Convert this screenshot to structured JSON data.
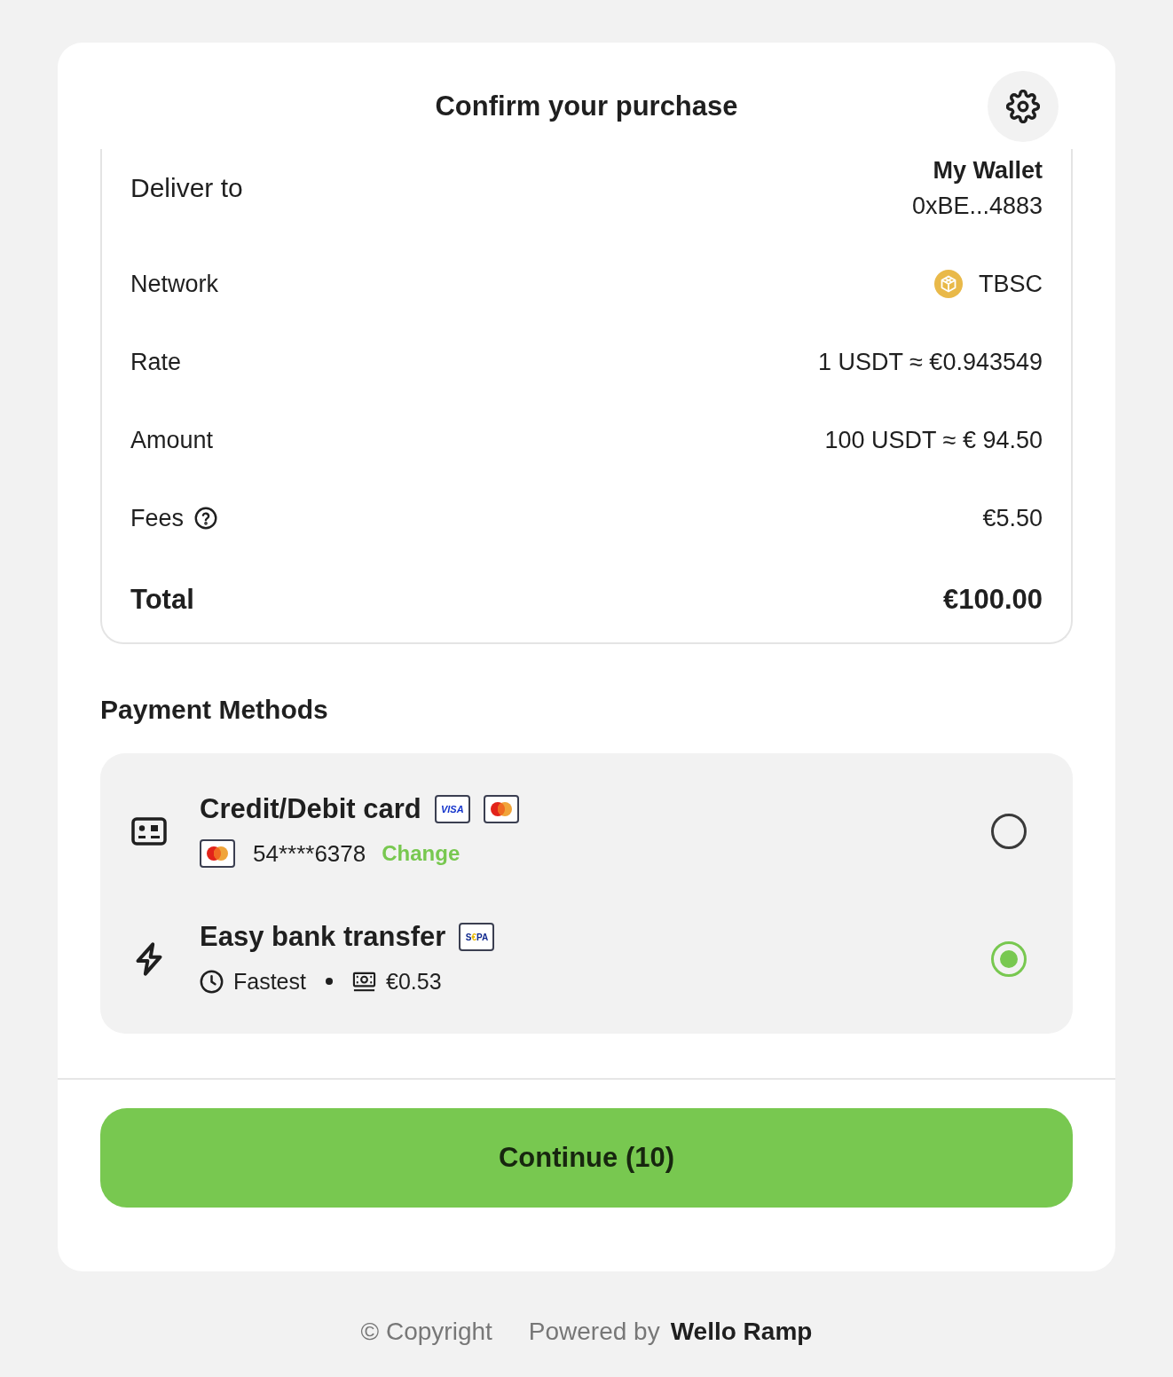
{
  "header": {
    "title": "Confirm your purchase"
  },
  "summary": {
    "rows": [
      {
        "kind": "wallet",
        "label": "Deliver to",
        "value": "My Wallet",
        "detail": "0xBE...4883"
      },
      {
        "kind": "network",
        "label": "Network",
        "value": "TBSC"
      },
      {
        "kind": "plain",
        "label": "Rate",
        "value": "1 USDT ≈ €0.943549"
      },
      {
        "kind": "plain",
        "label": "Amount",
        "value": "100 USDT ≈ € 94.50"
      },
      {
        "kind": "help",
        "label": "Fees",
        "value": "€5.50"
      },
      {
        "kind": "total",
        "label": "Total",
        "value": "€100.00"
      }
    ]
  },
  "payment": {
    "title": "Payment Methods",
    "methods": [
      {
        "kind": "card",
        "name": "Credit/Debit card",
        "badges": [
          {
            "kind": "visa",
            "text": "VISA"
          },
          {
            "kind": "mastercard"
          }
        ],
        "card": {
          "kind": "mastercard",
          "number": "54****6378",
          "action": "Change"
        },
        "selected": false
      },
      {
        "kind": "bank",
        "name": "Easy bank transfer",
        "badges": [
          {
            "kind": "sepa",
            "text": "S€PA"
          }
        ],
        "details": [
          {
            "kind": "time",
            "text": "Fastest"
          },
          {
            "kind": "fee",
            "text": "€0.53"
          }
        ],
        "selected": true
      }
    ]
  },
  "continue_button": {
    "label": "Continue (10)"
  },
  "footer": {
    "copyright": "© Copyright",
    "powered_by": "Powered by",
    "brand": "Wello Ramp"
  }
}
